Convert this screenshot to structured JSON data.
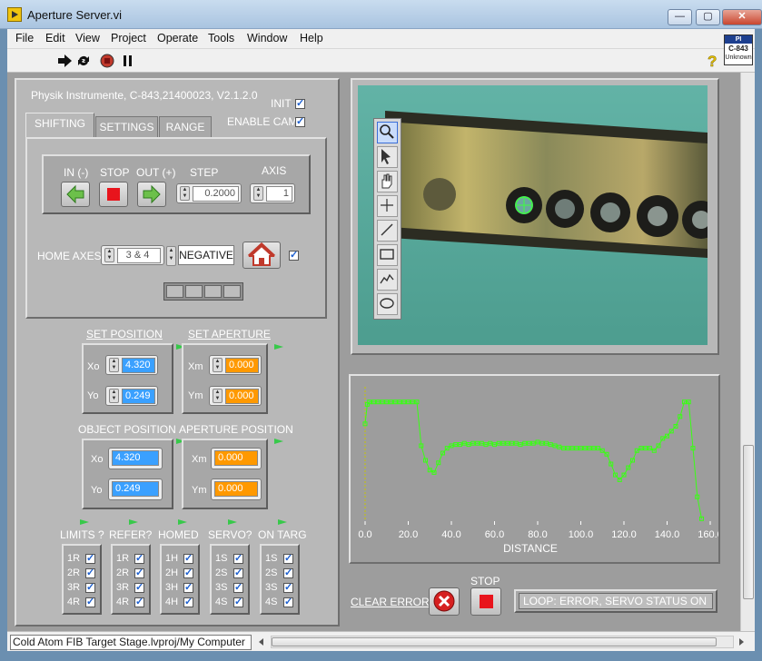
{
  "window": {
    "title": "Aperture Server.vi",
    "minimize": "—",
    "maximize": "▢",
    "close": "✕"
  },
  "menu": [
    "File",
    "Edit",
    "View",
    "Project",
    "Operate",
    "Tools",
    "Window",
    "Help"
  ],
  "badge": {
    "top": "PI",
    "model": "C-843",
    "status": "Unknown"
  },
  "controller_info": "Physik Instrumente, C-843,21400023, V2.1.2.0",
  "init_label": "INIT",
  "enable_cam_label": "ENABLE CAM",
  "tabs": [
    "SHIFTING",
    "SETTINGS",
    "RANGE"
  ],
  "shifting": {
    "in_label": "IN (-)",
    "stop_label": "STOP",
    "out_label": "OUT (+)",
    "step_label": "STEP",
    "step_value": "0.2000",
    "axis_label": "AXIS",
    "axis_value": "1",
    "home_axes_label": "HOME AXES",
    "home_axes_value": "3 & 4",
    "home_direction": "NEGATIVE"
  },
  "set_position": {
    "label": "SET POSITION",
    "xo_label": "Xo",
    "xo": "4.320",
    "yo_label": "Yo",
    "yo": "0.249"
  },
  "set_aperture": {
    "label": "SET APERTURE",
    "xm_label": "Xm",
    "xm": "0.000",
    "ym_label": "Ym",
    "ym": "0.000"
  },
  "object_position": {
    "label": "OBJECT POSITION",
    "xo_label": "Xo",
    "xo": "4.320",
    "yo_label": "Yo",
    "yo": "0.249"
  },
  "aperture_position": {
    "label": "APERTURE POSITION",
    "xm_label": "Xm",
    "xm": "0.000",
    "ym_label": "Ym",
    "ym": "0.000"
  },
  "status_groups": [
    {
      "title": "LIMITS ?",
      "items": [
        "1R",
        "2R",
        "3R",
        "4R"
      ]
    },
    {
      "title": "REFER?",
      "items": [
        "1R",
        "2R",
        "3R",
        "4R"
      ]
    },
    {
      "title": "HOMED",
      "items": [
        "1H",
        "2H",
        "3H",
        "4H"
      ]
    },
    {
      "title": "SERVO?",
      "items": [
        "1S",
        "2S",
        "3S",
        "4S"
      ]
    },
    {
      "title": "ON TARG",
      "items": [
        "1S",
        "2S",
        "3S",
        "4S"
      ]
    }
  ],
  "camera_tools": [
    "zoom-icon",
    "pointer-icon",
    "pan-hand-icon",
    "crosshair-icon",
    "line-tool-icon",
    "rectangle-tool-icon",
    "freehand-tool-icon",
    "ellipse-tool-icon"
  ],
  "chart_data": {
    "type": "line",
    "xlabel": "DISTANCE",
    "ylabel": "",
    "title": "",
    "xlim": [
      0,
      160
    ],
    "xticks": [
      "0.0",
      "20.0",
      "40.0",
      "60.0",
      "80.0",
      "100.0",
      "120.0",
      "140.0",
      "160.0"
    ],
    "ylim": [
      0,
      1
    ],
    "color": "#39ff14",
    "series": [
      {
        "x": [
          0,
          1,
          2,
          4,
          6,
          8,
          10,
          12,
          14,
          16,
          18,
          20,
          22,
          24,
          26,
          28,
          30,
          32,
          34,
          36,
          38,
          40,
          42,
          44,
          46,
          48,
          50,
          52,
          54,
          56,
          58,
          60,
          62,
          64,
          66,
          68,
          70,
          72,
          74,
          76,
          78,
          80,
          82,
          84,
          86,
          88,
          90,
          92,
          94,
          96,
          98,
          100,
          102,
          104,
          106,
          108,
          110,
          112,
          114,
          116,
          118,
          120,
          122,
          124,
          126,
          128,
          130,
          132,
          134,
          136,
          138,
          140,
          142,
          144,
          146,
          148,
          150,
          152,
          154,
          156
        ],
        "y": [
          0.8,
          0.96,
          0.98,
          0.98,
          0.98,
          0.98,
          0.98,
          0.98,
          0.98,
          0.98,
          0.98,
          0.98,
          0.98,
          0.98,
          0.62,
          0.5,
          0.42,
          0.4,
          0.48,
          0.56,
          0.6,
          0.62,
          0.63,
          0.63,
          0.64,
          0.63,
          0.64,
          0.64,
          0.64,
          0.63,
          0.64,
          0.63,
          0.64,
          0.64,
          0.64,
          0.64,
          0.64,
          0.63,
          0.64,
          0.64,
          0.64,
          0.65,
          0.64,
          0.64,
          0.63,
          0.62,
          0.61,
          0.6,
          0.6,
          0.6,
          0.6,
          0.6,
          0.6,
          0.6,
          0.6,
          0.6,
          0.58,
          0.55,
          0.47,
          0.38,
          0.34,
          0.38,
          0.44,
          0.5,
          0.58,
          0.6,
          0.6,
          0.6,
          0.58,
          0.62,
          0.68,
          0.7,
          0.74,
          0.78,
          0.86,
          0.98,
          0.98,
          0.6,
          0.2,
          0.02
        ]
      }
    ]
  },
  "stop_label": "STOP",
  "clear_errors_label": "CLEAR ERRORS",
  "loop_status": "LOOP: ERROR, SERVO STATUS ON",
  "project_path": "Cold Atom FIB Target Stage.lvproj/My Computer"
}
